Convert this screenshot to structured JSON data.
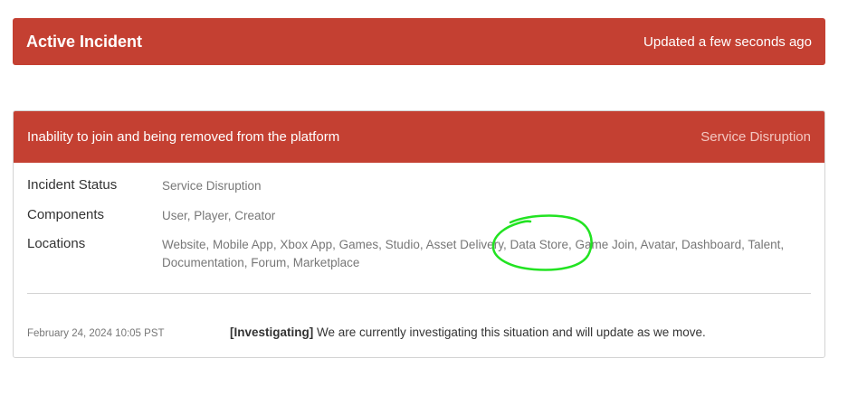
{
  "banner": {
    "title": "Active Incident",
    "updated": "Updated a few seconds ago"
  },
  "incident": {
    "title": "Inability to join and being removed from the platform",
    "type": "Service Disruption",
    "status_label": "Incident Status",
    "status_value": "Service Disruption",
    "components_label": "Components",
    "components_value": "User, Player, Creator",
    "locations_label": "Locations",
    "locations_value": "Website, Mobile App, Xbox App, Games, Studio, Asset Delivery, Data Store, Game Join, Avatar, Dashboard, Talent, Documentation, Forum, Marketplace"
  },
  "update": {
    "timestamp": "February 24, 2024 10:05 PST",
    "stage": "[Investigating]",
    "message": " We are currently investigating this situation and will update as we move."
  },
  "colors": {
    "header_red": "#c44032",
    "annotation_green": "#22e322"
  },
  "annotation": {
    "shape": "freehand-circle",
    "target": "Data Store"
  }
}
